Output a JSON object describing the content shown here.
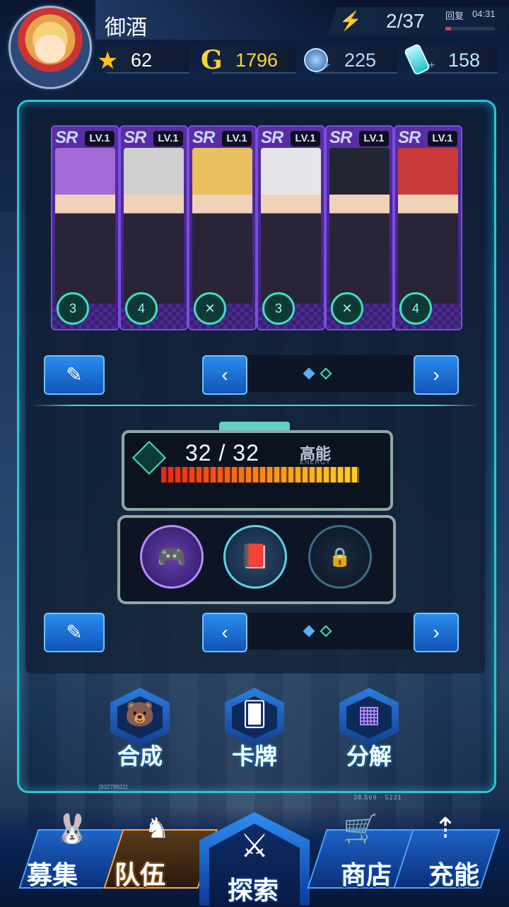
{
  "player": {
    "name": "御酒",
    "level": "62"
  },
  "resources": {
    "stamina": "2/37",
    "recover_label": "回复",
    "recover_time": "04:31",
    "recover_fraction": 0.12,
    "gold": "1796",
    "gems": "225",
    "potions": "158",
    "plus": "+"
  },
  "team": {
    "cards": [
      {
        "rarity": "SR",
        "level": "LV.1",
        "element": "3",
        "hair": "#a46ad8"
      },
      {
        "rarity": "SR",
        "level": "LV.1",
        "element": "4",
        "hair": "#cfcfcf"
      },
      {
        "rarity": "SR",
        "level": "LV.1",
        "element": "✕",
        "hair": "#e8c060"
      },
      {
        "rarity": "SR",
        "level": "LV.1",
        "element": "3",
        "hair": "#e6e6ea"
      },
      {
        "rarity": "SR",
        "level": "LV.1",
        "element": "✕",
        "hair": "#222633"
      },
      {
        "rarity": "SR",
        "level": "LV.1",
        "element": "4",
        "hair": "#c83a3a"
      }
    ],
    "edit_glyph": "✎",
    "prev_glyph": "‹",
    "next_glyph": "›"
  },
  "energy": {
    "value": "32 / 32",
    "label": "高能",
    "sublabel": "ENERGY",
    "fill_fraction": 1.0
  },
  "equipment": {
    "items": [
      "game-console",
      "book",
      "locked"
    ],
    "lock_glyph": "🔒"
  },
  "actions": [
    {
      "label": "合成",
      "icon": "bear-icon",
      "glyph": "🐻"
    },
    {
      "label": "卡牌",
      "icon": "cards-icon",
      "glyph": "🂠"
    },
    {
      "label": "分解",
      "icon": "cubes-icon",
      "glyph": "▦"
    }
  ],
  "coords": {
    "a": "38.569  ·  5231",
    "b": "[93278821]"
  },
  "nav": [
    {
      "label": "募集",
      "icon": "rabbit-icon",
      "glyph": "🐰"
    },
    {
      "label": "队伍",
      "icon": "knight-icon",
      "glyph": "♞"
    },
    {
      "label": "探索",
      "icon": "castle-icon",
      "glyph": "⚔"
    },
    {
      "label": "商店",
      "icon": "cart-icon",
      "glyph": "🛒"
    },
    {
      "label": "充能",
      "icon": "vial-icon",
      "glyph": "⇡"
    }
  ],
  "colors": {
    "accent": "#27c6d2",
    "gold": "#ffd23a",
    "active_tab": "#ffa83a"
  }
}
